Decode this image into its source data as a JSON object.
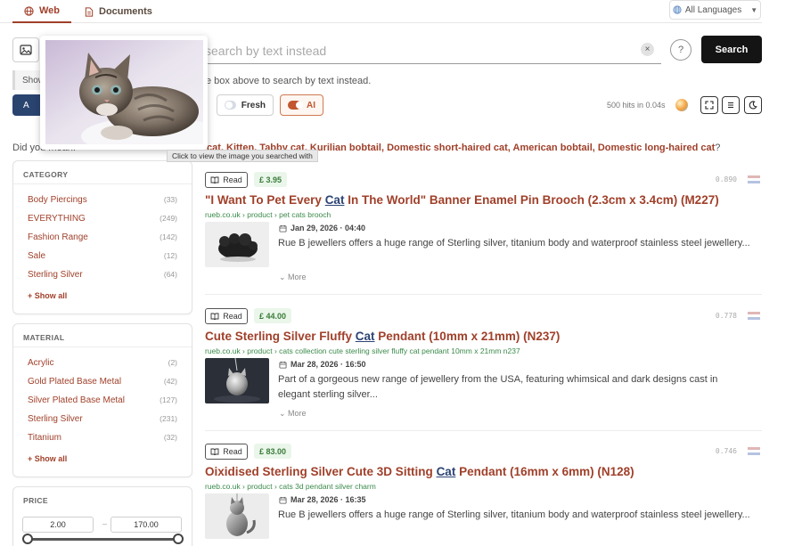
{
  "tabs": [
    {
      "label": "Web",
      "icon": "globe-icon"
    },
    {
      "label": "Documents",
      "icon": "document-icon"
    }
  ],
  "language": {
    "label": "All Languages",
    "icon": "globe-icon"
  },
  "search": {
    "placeholder": "search by text instead",
    "button_label": "Search",
    "clear_glyph": "×",
    "help_glyph": "?"
  },
  "notice": {
    "prefix": "Show",
    "rest": "e box above to search by text instead."
  },
  "filters": {
    "dark_button_label": "A",
    "fresh_label": "Fresh",
    "ai_label": "AI",
    "hits": "500 hits in 0.04s",
    "tools": [
      "expand-icon",
      "list-icon",
      "moon-icon"
    ]
  },
  "did_you_mean": {
    "prefix": "Did you mean:",
    "links": "cat, Kitten, Tabby cat, Kurilian bobtail, Domestic short-haired cat, American bobtail, Domestic long-haired cat",
    "suffix": "?"
  },
  "popup": {
    "tooltip": "Click to view the image you searched with"
  },
  "sidebar": {
    "category": {
      "title": "CATEGORY",
      "items": [
        {
          "label": "Body Piercings",
          "count": "(33)"
        },
        {
          "label": "EVERYTHING",
          "count": "(249)"
        },
        {
          "label": "Fashion Range",
          "count": "(142)"
        },
        {
          "label": "Sale",
          "count": "(12)"
        },
        {
          "label": "Sterling Silver",
          "count": "(64)"
        }
      ],
      "show_all": "+ Show all"
    },
    "material": {
      "title": "MATERIAL",
      "items": [
        {
          "label": "Acrylic",
          "count": "(2)"
        },
        {
          "label": "Gold Plated Base Metal",
          "count": "(42)"
        },
        {
          "label": "Silver Plated Base Metal",
          "count": "(127)"
        },
        {
          "label": "Sterling Silver",
          "count": "(231)"
        },
        {
          "label": "Titanium",
          "count": "(32)"
        }
      ],
      "show_all": "+ Show all"
    },
    "price": {
      "title": "PRICE",
      "min": "2.00",
      "max": "170.00",
      "dash": "–"
    }
  },
  "results": [
    {
      "read_label": "Read",
      "price": "£ 3.95",
      "score": "0.890",
      "title_pre": "\"I Want To Pet Every ",
      "title_hl": "Cat",
      "title_post": " In The World\" Banner Enamel Pin Brooch (2.3cm x 3.4cm) (M227)",
      "url": "rueb.co.uk › product › pet cats brooch",
      "date": "Jan 29, 2026 · 04:40",
      "desc": "Rue B jewellers offers a huge range of Sterling silver, titanium body and waterproof stainless steel jewellery...",
      "more": "More"
    },
    {
      "read_label": "Read",
      "price": "£ 44.00",
      "score": "0.778",
      "title_pre": "Cute Sterling Silver Fluffy ",
      "title_hl": "Cat",
      "title_post": " Pendant (10mm x 21mm) (N237)",
      "url": "rueb.co.uk › product › cats collection cute sterling silver fluffy cat pendant 10mm x 21mm n237",
      "date": "Mar 28, 2026 · 16:50",
      "desc": "Part of a gorgeous new range of jewellery from the USA, featuring whimsical and dark designs cast in elegant sterling silver...",
      "more": "More"
    },
    {
      "read_label": "Read",
      "price": "£ 83.00",
      "score": "0.746",
      "title_pre": "Oixidised Sterling Silver Cute 3D Sitting ",
      "title_hl": "Cat",
      "title_post": " Pendant (16mm x 6mm) (N128)",
      "url": "rueb.co.uk › product › cats 3d pendant silver charm",
      "date": "Mar 28, 2026 · 16:35",
      "desc": "Rue B jewellers offers a huge range of Sterling silver, titanium body and waterproof stainless steel jewellery...",
      "more": "More"
    }
  ],
  "colors": {
    "accent": "#a0402a",
    "link_highlight": "#2c4373",
    "url_green": "#3a8a4a",
    "search_button": "#141414",
    "filter_button": "#2a4470"
  }
}
